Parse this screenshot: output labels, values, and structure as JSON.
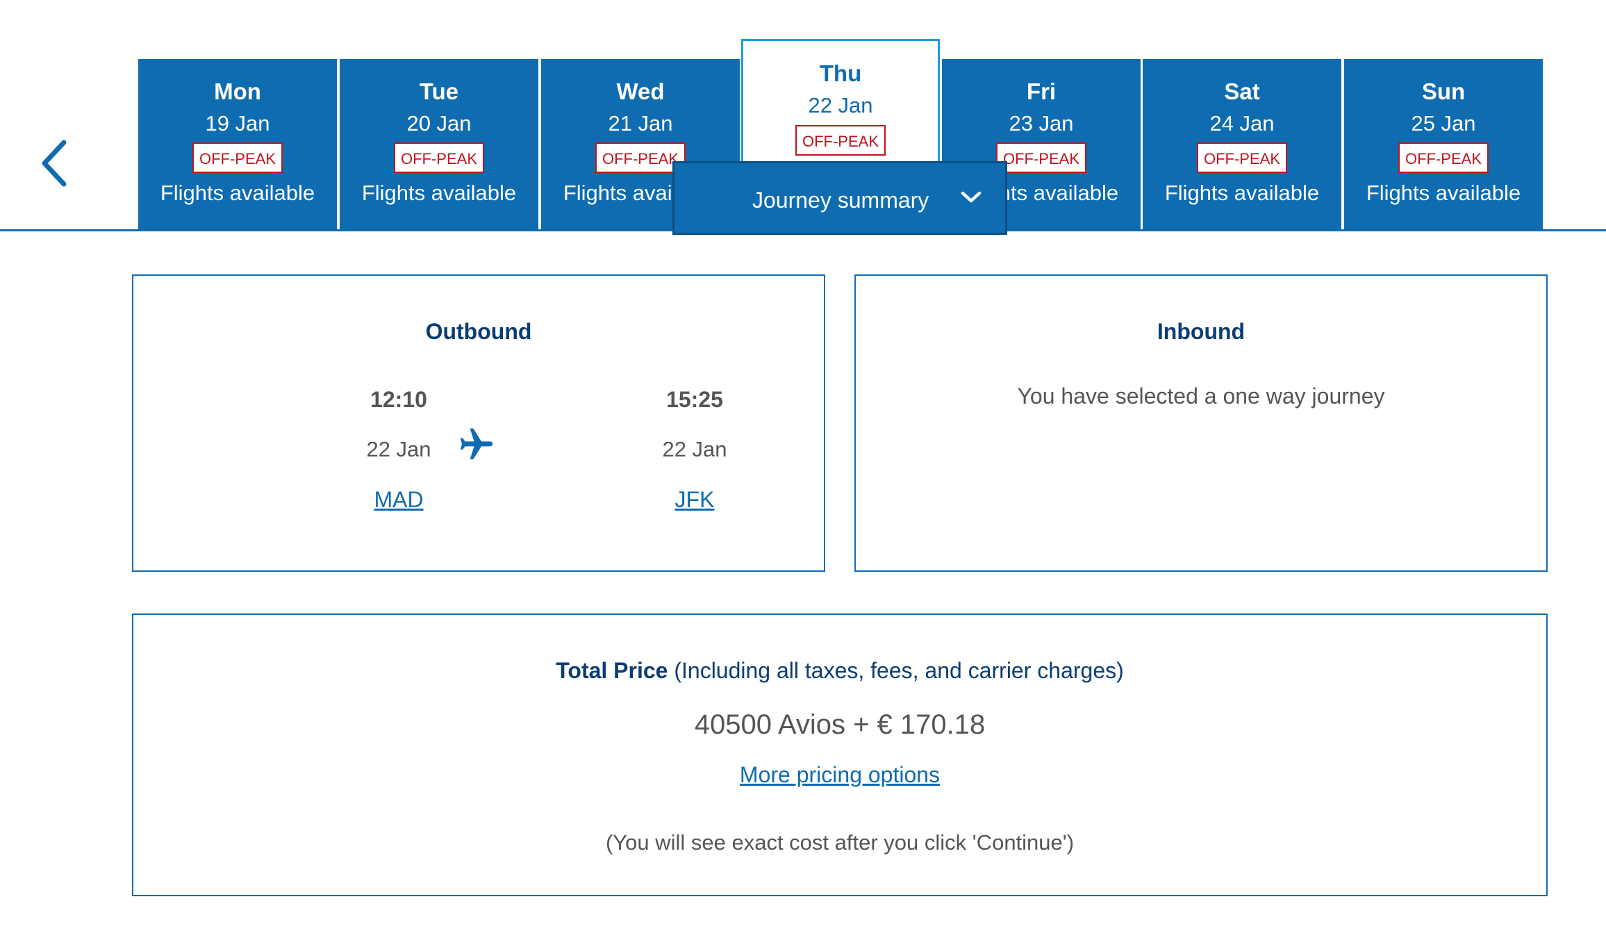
{
  "colors": {
    "brand_blue": "#0f6cb0",
    "dark_blue": "#0b3d73",
    "selected_border": "#1a9be0",
    "offpeak_red": "#c0141e"
  },
  "nav": {
    "prev_icon": "chevron-left-icon"
  },
  "days": [
    {
      "day": "Mon",
      "date": "19 Jan",
      "badge": "OFF-PEAK",
      "status": "Flights available"
    },
    {
      "day": "Tue",
      "date": "20 Jan",
      "badge": "OFF-PEAK",
      "status": "Flights available"
    },
    {
      "day": "Wed",
      "date": "21 Jan",
      "badge": "OFF-PEAK",
      "status": "Flights available"
    },
    {
      "day": "Thu",
      "date": "22 Jan",
      "badge": "OFF-PEAK",
      "status": ""
    },
    {
      "day": "Fri",
      "date": "23 Jan",
      "badge": "OFF-PEAK",
      "status": "Flights available"
    },
    {
      "day": "Sat",
      "date": "24 Jan",
      "badge": "OFF-PEAK",
      "status": "Flights available"
    },
    {
      "day": "Sun",
      "date": "25 Jan",
      "badge": "OFF-PEAK",
      "status": "Flights available"
    }
  ],
  "journey_summary": {
    "label": "Journey summary",
    "icon": "chevron-down-icon"
  },
  "outbound": {
    "title": "Outbound",
    "depart": {
      "time": "12:10",
      "date": "22 Jan",
      "code": "MAD"
    },
    "arrive": {
      "time": "15:25",
      "date": "22 Jan",
      "code": "JFK"
    },
    "icon": "plane-icon"
  },
  "inbound": {
    "title": "Inbound",
    "message": "You have selected a one way journey"
  },
  "price": {
    "label": "Total Price",
    "note": "(Including all taxes, fees, and carrier charges)",
    "amount": "40500 Avios + € 170.18",
    "more_link": "More pricing options",
    "footer": "(You will see exact cost after you click 'Continue')"
  }
}
